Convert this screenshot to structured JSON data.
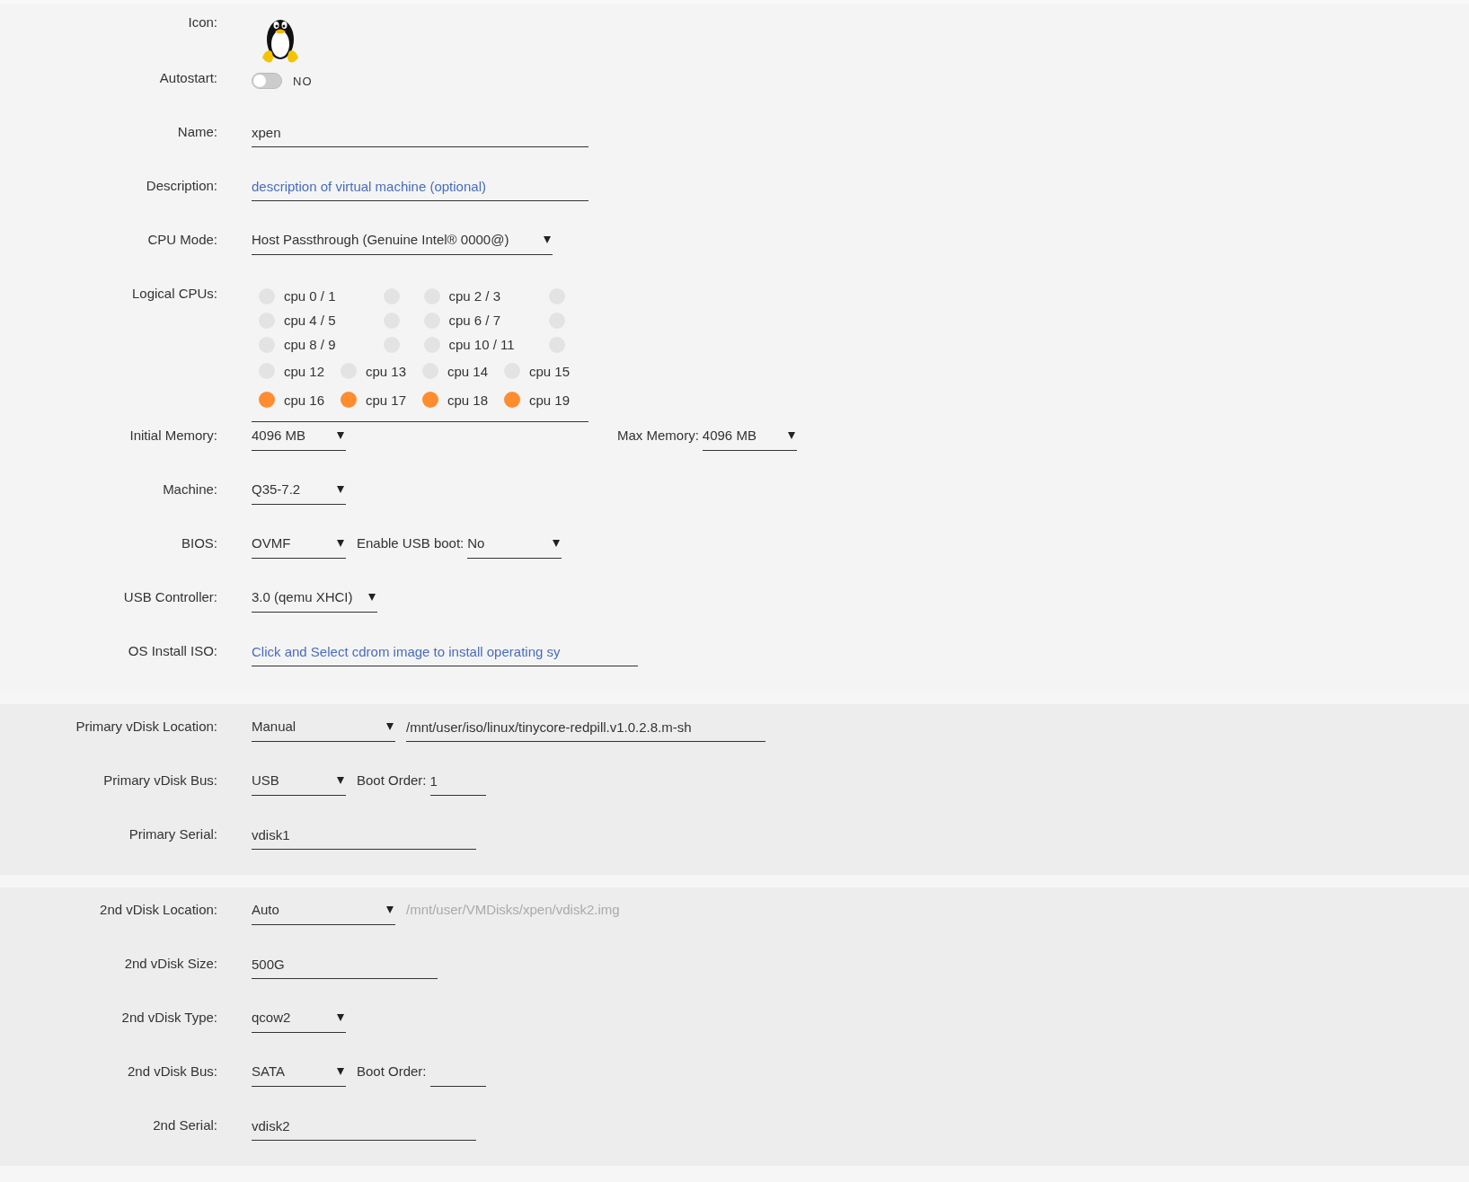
{
  "sections": [
    {
      "rows": [
        {
          "label": "Icon:",
          "items": [
            {
              "kind": "icon"
            }
          ]
        },
        {
          "label": "Autostart:",
          "items": [
            {
              "kind": "toggle",
              "on": false,
              "text": "NO"
            }
          ]
        },
        {
          "label": "Name:",
          "items": [
            {
              "kind": "input",
              "value": "xpen"
            }
          ]
        },
        {
          "label": "Description:",
          "items": [
            {
              "kind": "input",
              "placeholder": "description of virtual machine (optional)"
            }
          ]
        },
        {
          "label": "CPU Mode:",
          "items": [
            {
              "kind": "select",
              "value": "Host Passthrough (Genuine Intel® 0000@)"
            }
          ]
        },
        {
          "label": "Logical CPUs:",
          "items": [
            {
              "kind": "cpus",
              "rows": [
                {
                  "kind": "pairs",
                  "cpus": [
                    {
                      "label": "cpu 0 / 1",
                      "checked": false
                    },
                    {
                      "checked": false
                    },
                    {
                      "label": "cpu 2 / 3",
                      "checked": false
                    },
                    {
                      "checked": false
                    }
                  ]
                },
                {
                  "kind": "pairs",
                  "cpus": [
                    {
                      "label": "cpu 4 / 5",
                      "checked": false
                    },
                    {
                      "checked": false
                    },
                    {
                      "label": "cpu 6 / 7",
                      "checked": false
                    },
                    {
                      "checked": false
                    }
                  ]
                },
                {
                  "kind": "pairs",
                  "cpus": [
                    {
                      "label": "cpu 8 / 9",
                      "checked": false
                    },
                    {
                      "checked": false
                    },
                    {
                      "label": "cpu 10 / 11",
                      "checked": false
                    },
                    {
                      "checked": false
                    }
                  ]
                },
                {
                  "kind": "single",
                  "cpus": [
                    {
                      "label": "cpu 12",
                      "checked": false
                    },
                    {
                      "label": "cpu 13",
                      "checked": false
                    },
                    {
                      "label": "cpu 14",
                      "checked": false
                    },
                    {
                      "label": "cpu 15",
                      "checked": false
                    }
                  ]
                },
                {
                  "kind": "single",
                  "cpus": [
                    {
                      "label": "cpu 16",
                      "checked": true
                    },
                    {
                      "label": "cpu 17",
                      "checked": true
                    },
                    {
                      "label": "cpu 18",
                      "checked": true
                    },
                    {
                      "label": "cpu 19",
                      "checked": true
                    }
                  ]
                }
              ]
            }
          ]
        },
        {
          "label": "Initial Memory:",
          "items": [
            {
              "kind": "select",
              "value": "4096 MB"
            },
            {
              "kind": "text",
              "text": "Max Memory:"
            },
            {
              "kind": "select",
              "value": "4096 MB"
            }
          ]
        },
        {
          "label": "Machine:",
          "items": [
            {
              "kind": "select",
              "value": "Q35-7.2"
            }
          ]
        },
        {
          "label": "BIOS:",
          "items": [
            {
              "kind": "select",
              "value": "OVMF"
            },
            {
              "kind": "text",
              "text": "Enable USB boot:"
            },
            {
              "kind": "select",
              "value": "No"
            }
          ]
        },
        {
          "label": "USB Controller:",
          "items": [
            {
              "kind": "select",
              "value": "3.0 (qemu XHCI)"
            }
          ]
        },
        {
          "label": "OS Install ISO:",
          "items": [
            {
              "kind": "input",
              "placeholder": "Click and Select cdrom image to install operating sy"
            }
          ]
        }
      ]
    },
    {
      "rows": [
        {
          "label": "Primary vDisk Location:",
          "items": [
            {
              "kind": "select",
              "value": "Manual"
            },
            {
              "kind": "input",
              "value": "/mnt/user/iso/linux/tinycore-redpill.v1.0.2.8.m-sh"
            }
          ]
        },
        {
          "label": "Primary vDisk Bus:",
          "items": [
            {
              "kind": "select",
              "value": "USB"
            },
            {
              "kind": "text",
              "text": "Boot Order:"
            },
            {
              "kind": "input",
              "value": "1"
            }
          ]
        },
        {
          "label": "Primary Serial:",
          "items": [
            {
              "kind": "input",
              "value": "vdisk1"
            }
          ]
        }
      ]
    },
    {
      "rows": [
        {
          "label": "2nd vDisk Location:",
          "items": [
            {
              "kind": "select",
              "value": "Auto"
            },
            {
              "kind": "path",
              "text": "/mnt/user/VMDisks/xpen/vdisk2.img"
            }
          ]
        },
        {
          "label": "2nd vDisk Size:",
          "items": [
            {
              "kind": "input",
              "value": "500G"
            }
          ]
        },
        {
          "label": "2nd vDisk Type:",
          "items": [
            {
              "kind": "select",
              "value": "qcow2"
            }
          ]
        },
        {
          "label": "2nd vDisk Bus:",
          "items": [
            {
              "kind": "select",
              "value": "SATA"
            },
            {
              "kind": "text",
              "text": "Boot Order:"
            },
            {
              "kind": "input"
            }
          ]
        },
        {
          "label": "2nd Serial:",
          "items": [
            {
              "kind": "input",
              "value": "vdisk2"
            }
          ]
        }
      ]
    }
  ]
}
